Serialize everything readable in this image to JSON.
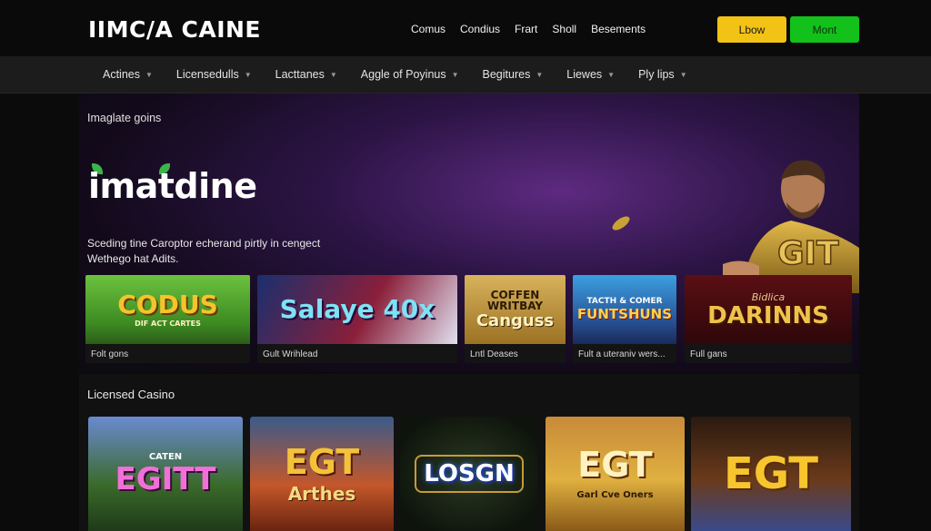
{
  "header": {
    "logo": "IIMC/A CAINE",
    "nav": [
      "Comus",
      "Condius",
      "Frart",
      "Sholl",
      "Besements"
    ],
    "btn_primary": "Lbow",
    "btn_secondary": "Mont"
  },
  "subnav": {
    "items": [
      "Actines",
      "Licensedulls",
      "Lacttanes",
      "Aggle of Poyinus",
      "Begitures",
      "Liewes",
      "Ply lips"
    ]
  },
  "hero": {
    "title": "Imaglate goins",
    "brand": "imatdine",
    "desc_line1": "Sceding tine Caroptor echerand pirtly in cengect",
    "desc_line2": "Wethego hat Adits.",
    "figure_badge": "GIT"
  },
  "games_row": [
    {
      "art": "CODUS",
      "art_sub": "DIF ACT CARTES",
      "label": "Folt gons"
    },
    {
      "art": "Salaye 40x",
      "label": "Gult Wrihlead"
    },
    {
      "art": "COFFEN WRITBAY",
      "art_sub": "Canguss",
      "label": "Lntl Deases"
    },
    {
      "art": "TACTH & COMER",
      "art_sub": "FUNTSHUNS",
      "label": "Fult a uteraniv wers..."
    },
    {
      "art_top": "Bidlica",
      "art": "DARINNS",
      "label": "Full gans"
    }
  ],
  "licensed": {
    "title": "Licensed Casino",
    "tiles": [
      {
        "top": "CATEN",
        "art": "EGITT"
      },
      {
        "art": "EGT",
        "sub": "Arthes"
      },
      {
        "art": "LOSGN"
      },
      {
        "art": "EGT",
        "sub": "Garl Cve Oners"
      },
      {
        "art": "EGT"
      }
    ]
  },
  "colors": {
    "accent_yellow": "#f2c215",
    "accent_green": "#12c21a",
    "bg": "#0b0b0b"
  }
}
